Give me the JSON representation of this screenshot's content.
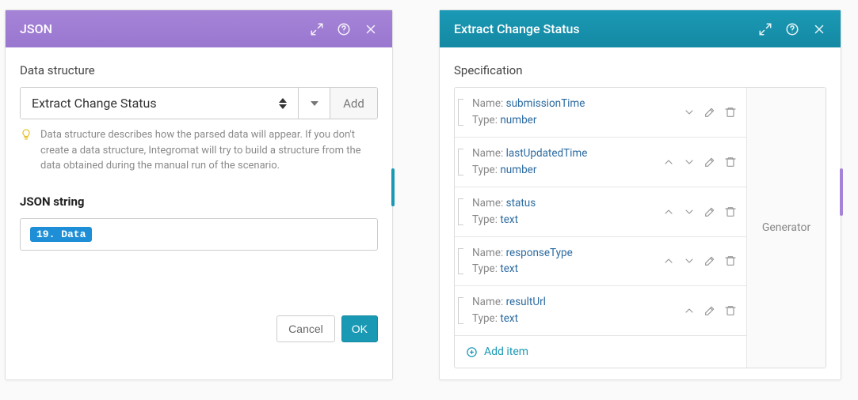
{
  "left": {
    "title": "JSON",
    "section1_label": "Data structure",
    "select_value": "Extract Change Status",
    "add_button": "Add",
    "hint_text": "Data structure describes how the parsed data will appear. If you don't create a data structure, Integromat will try to build a structure from the data obtained during the manual run of the scenario.",
    "section2_label": "JSON string",
    "pill_text": "19. Data",
    "cancel_label": "Cancel",
    "ok_label": "OK"
  },
  "right": {
    "title": "Extract Change Status",
    "section_label": "Specification",
    "generator_label": "Generator",
    "name_key": "Name:",
    "type_key": "Type:",
    "items": [
      {
        "name": "submissionTime",
        "type": "number",
        "can_up": false,
        "can_down": true
      },
      {
        "name": "lastUpdatedTime",
        "type": "number",
        "can_up": true,
        "can_down": true
      },
      {
        "name": "status",
        "type": "text",
        "can_up": true,
        "can_down": true
      },
      {
        "name": "responseType",
        "type": "text",
        "can_up": true,
        "can_down": true
      },
      {
        "name": "resultUrl",
        "type": "text",
        "can_up": true,
        "can_down": false
      }
    ],
    "add_item_label": "Add item"
  }
}
